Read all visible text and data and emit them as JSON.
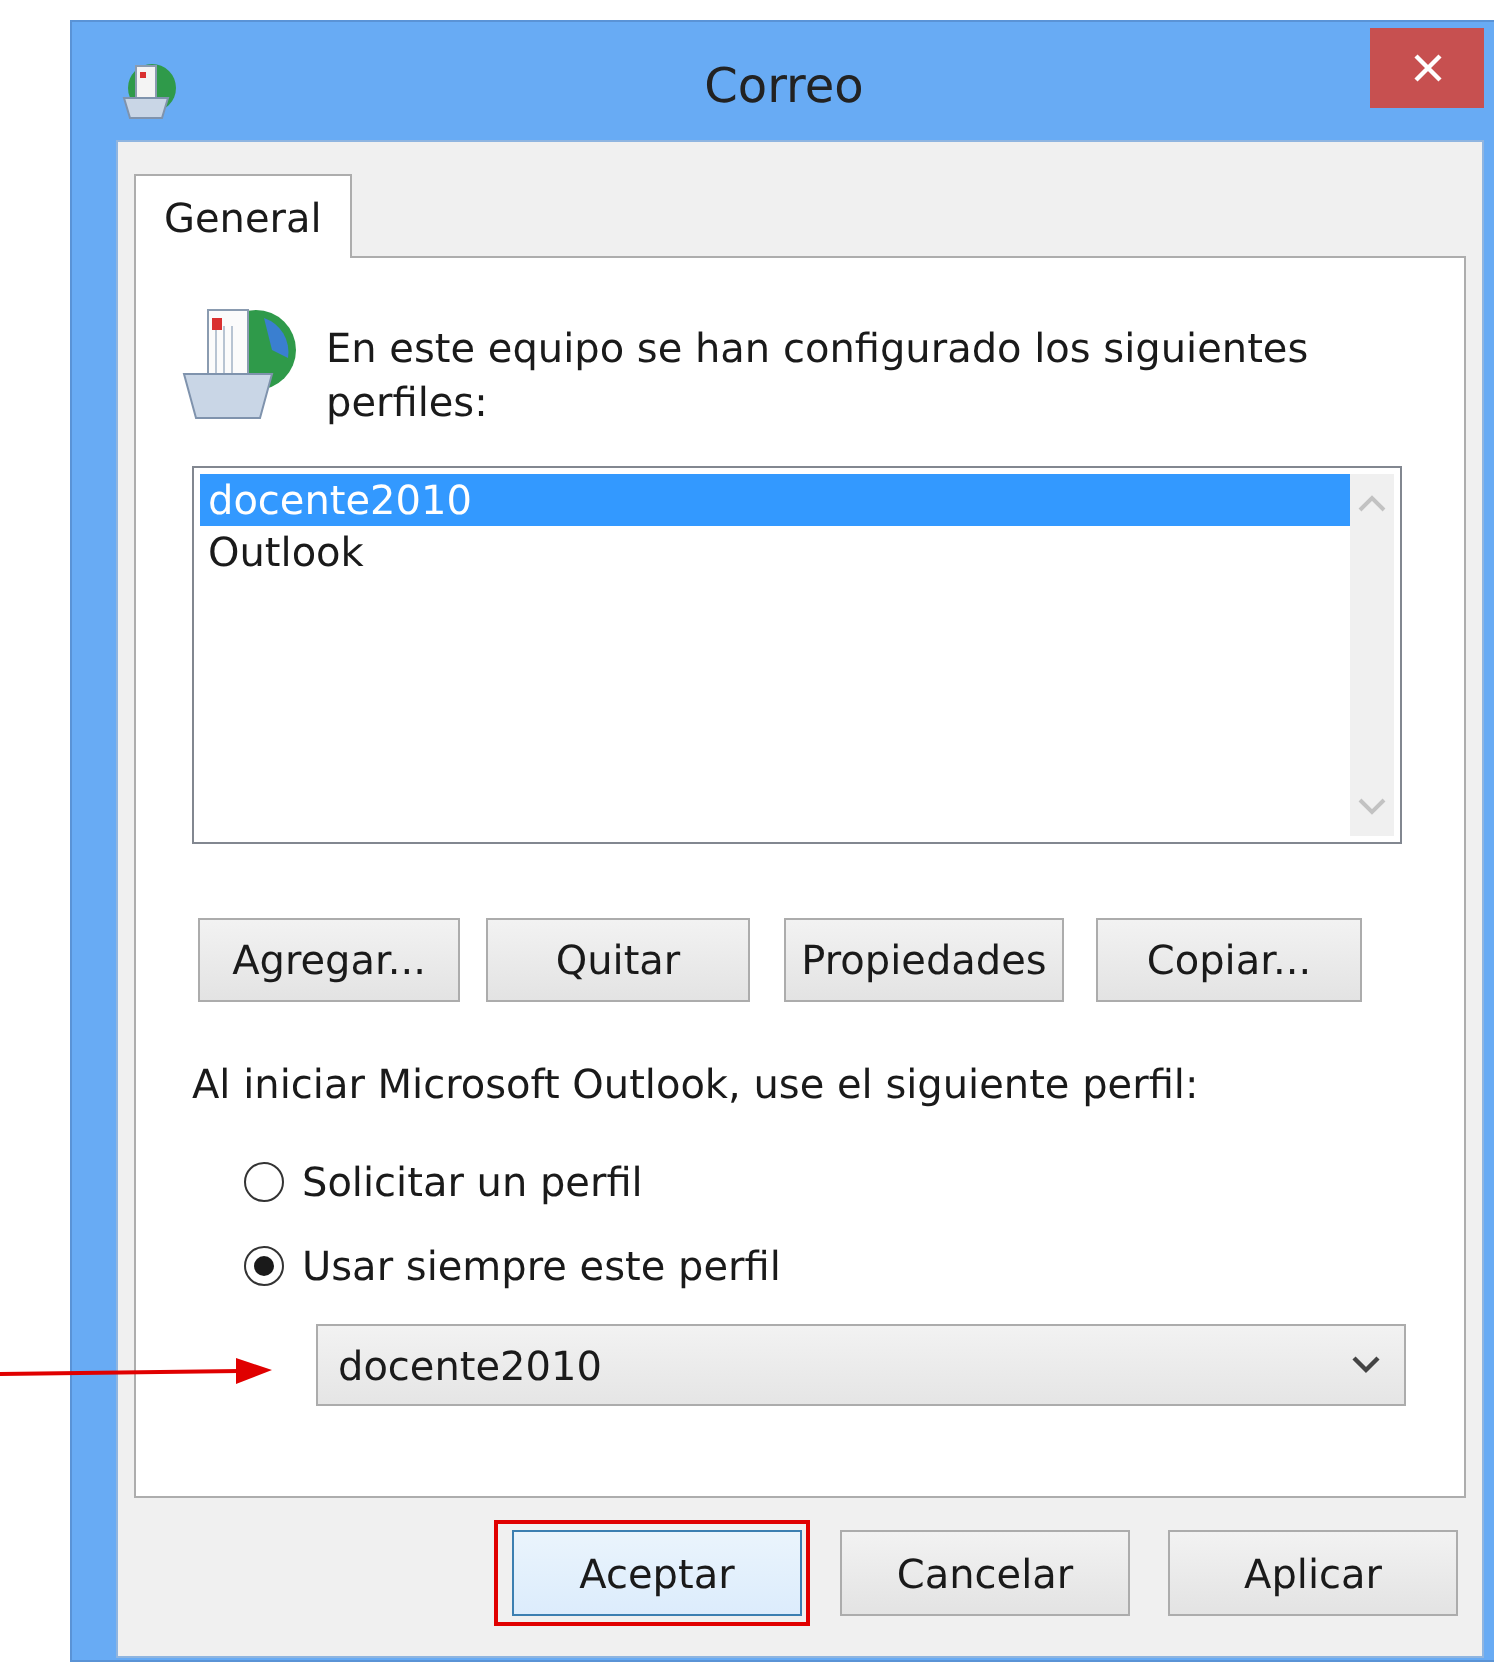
{
  "window": {
    "title": "Correo"
  },
  "tabs": [
    {
      "label": "General",
      "selected": true
    }
  ],
  "intro": "En este equipo se han configurado los siguientes perfiles:",
  "profiles": [
    {
      "name": "docente2010",
      "selected": true
    },
    {
      "name": "Outlook",
      "selected": false
    }
  ],
  "profile_buttons": [
    "Agregar...",
    "Quitar",
    "Propiedades",
    "Copiar..."
  ],
  "startup_label": "Al iniciar Microsoft Outlook, use el siguiente perfil:",
  "startup_options": [
    {
      "label": "Solicitar un perfil",
      "selected": false
    },
    {
      "label": "Usar siempre este perfil",
      "selected": true
    }
  ],
  "profile_dropdown": {
    "value": "docente2010"
  },
  "dialog_buttons": [
    {
      "label": "Aceptar",
      "default": true,
      "highlighted": true
    },
    {
      "label": "Cancelar",
      "default": false,
      "highlighted": false
    },
    {
      "label": "Aplicar",
      "default": false,
      "highlighted": false
    }
  ],
  "annotation_arrow": true
}
